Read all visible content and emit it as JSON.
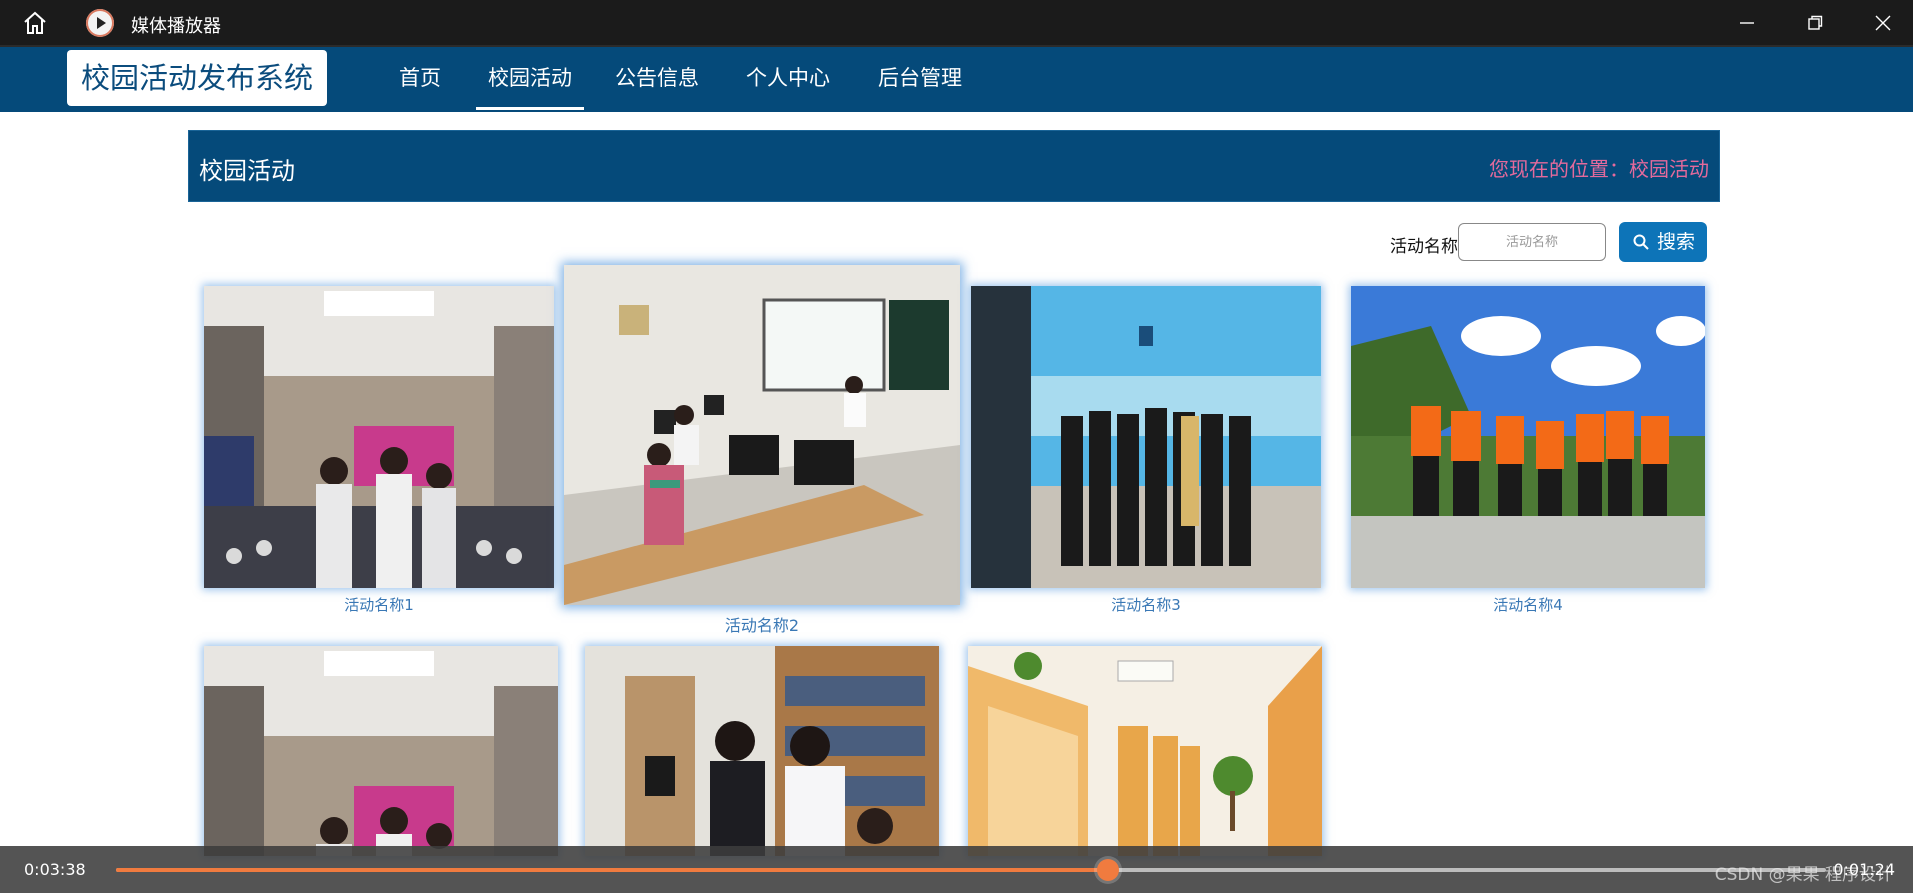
{
  "window": {
    "title": "媒体播放器"
  },
  "navbar": {
    "logo": "校园活动发布系统",
    "items": [
      {
        "label": "首页"
      },
      {
        "label": "校园活动",
        "active": true
      },
      {
        "label": "公告信息"
      },
      {
        "label": "个人中心"
      },
      {
        "label": "后台管理"
      }
    ]
  },
  "section": {
    "title": "校园活动",
    "location": "您现在的位置：校园活动"
  },
  "search": {
    "label": "活动名称",
    "placeholder": "活动名称",
    "button": "搜索"
  },
  "activities": [
    {
      "name": "活动名称1",
      "scene": "auditorium"
    },
    {
      "name": "活动名称2",
      "scene": "computer-lab"
    },
    {
      "name": "活动名称3",
      "scene": "stage-group"
    },
    {
      "name": "活动名称4",
      "scene": "outdoor-rafting"
    },
    {
      "name": "",
      "scene": "auditorium"
    },
    {
      "name": "",
      "scene": "library"
    },
    {
      "name": "",
      "scene": "study-room"
    }
  ],
  "player": {
    "elapsed": "0:03:38",
    "remaining": "0:01:24",
    "progress": 0.58,
    "watermark": "CSDN @果果  程序设计"
  },
  "colors": {
    "nav": "#054a7a",
    "accent": "#0d74b8",
    "location": "#e46a9c",
    "progress": "#f07b3f"
  },
  "icons": [
    "home-icon",
    "media-player-icon",
    "minimize-icon",
    "maximize-icon",
    "close-icon",
    "search-icon"
  ]
}
